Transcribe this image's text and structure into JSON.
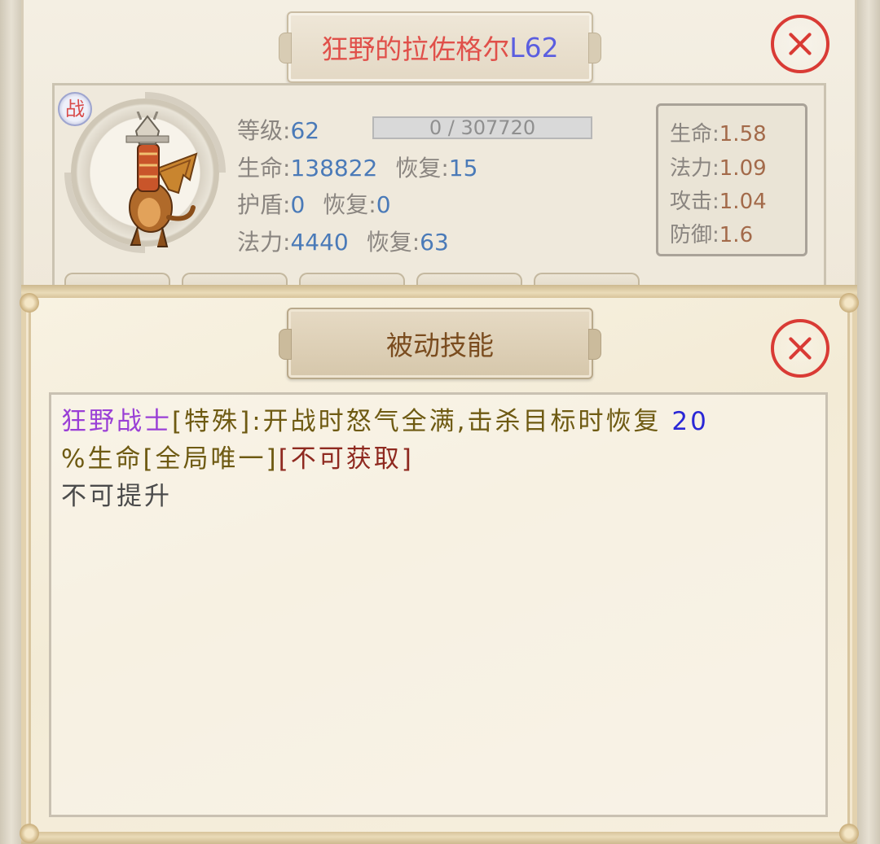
{
  "pet_window": {
    "name": "狂野的拉佐格尔",
    "level_tag": "L62",
    "battle_badge": "战",
    "stats": {
      "level_label": "等级:",
      "level_value": "62",
      "xp_text": "0 / 307720",
      "hp_label": "生命:",
      "hp_value": "138822",
      "hp_regen_label": "恢复:",
      "hp_regen_value": "15",
      "shield_label": "护盾:",
      "shield_value": "0",
      "shield_regen_label": "恢复:",
      "shield_regen_value": "0",
      "mp_label": "法力:",
      "mp_value": "4440",
      "mp_regen_label": "恢复:",
      "mp_regen_value": "63"
    },
    "growth": {
      "hp_label": "生命:",
      "hp_value": "1.58",
      "mp_label": "法力:",
      "mp_value": "1.09",
      "atk_label": "攻击:",
      "atk_value": "1.04",
      "def_label": "防御:",
      "def_value": "1.6"
    },
    "close_icon": "close-x-icon"
  },
  "skill_window": {
    "title": "被动技能",
    "skill_name": "狂野战士",
    "skill_tag": "[特殊]",
    "desc_part1": ":开战时怒气全满,击杀目标时恢复",
    "desc_number": "20",
    "desc_part2": "%生命[全局唯一]",
    "not_obtainable": "[不可获取]",
    "upgrade_note": "不可提升",
    "close_icon": "close-x-icon"
  },
  "colors": {
    "close_red": "#d93b35",
    "name_red": "#e0504a",
    "level_blue": "#5b5ee0",
    "stat_value_blue": "#4a7ab8",
    "growth_value_brown": "#a36a4a",
    "skill_name_purple": "#9a3fd6"
  }
}
